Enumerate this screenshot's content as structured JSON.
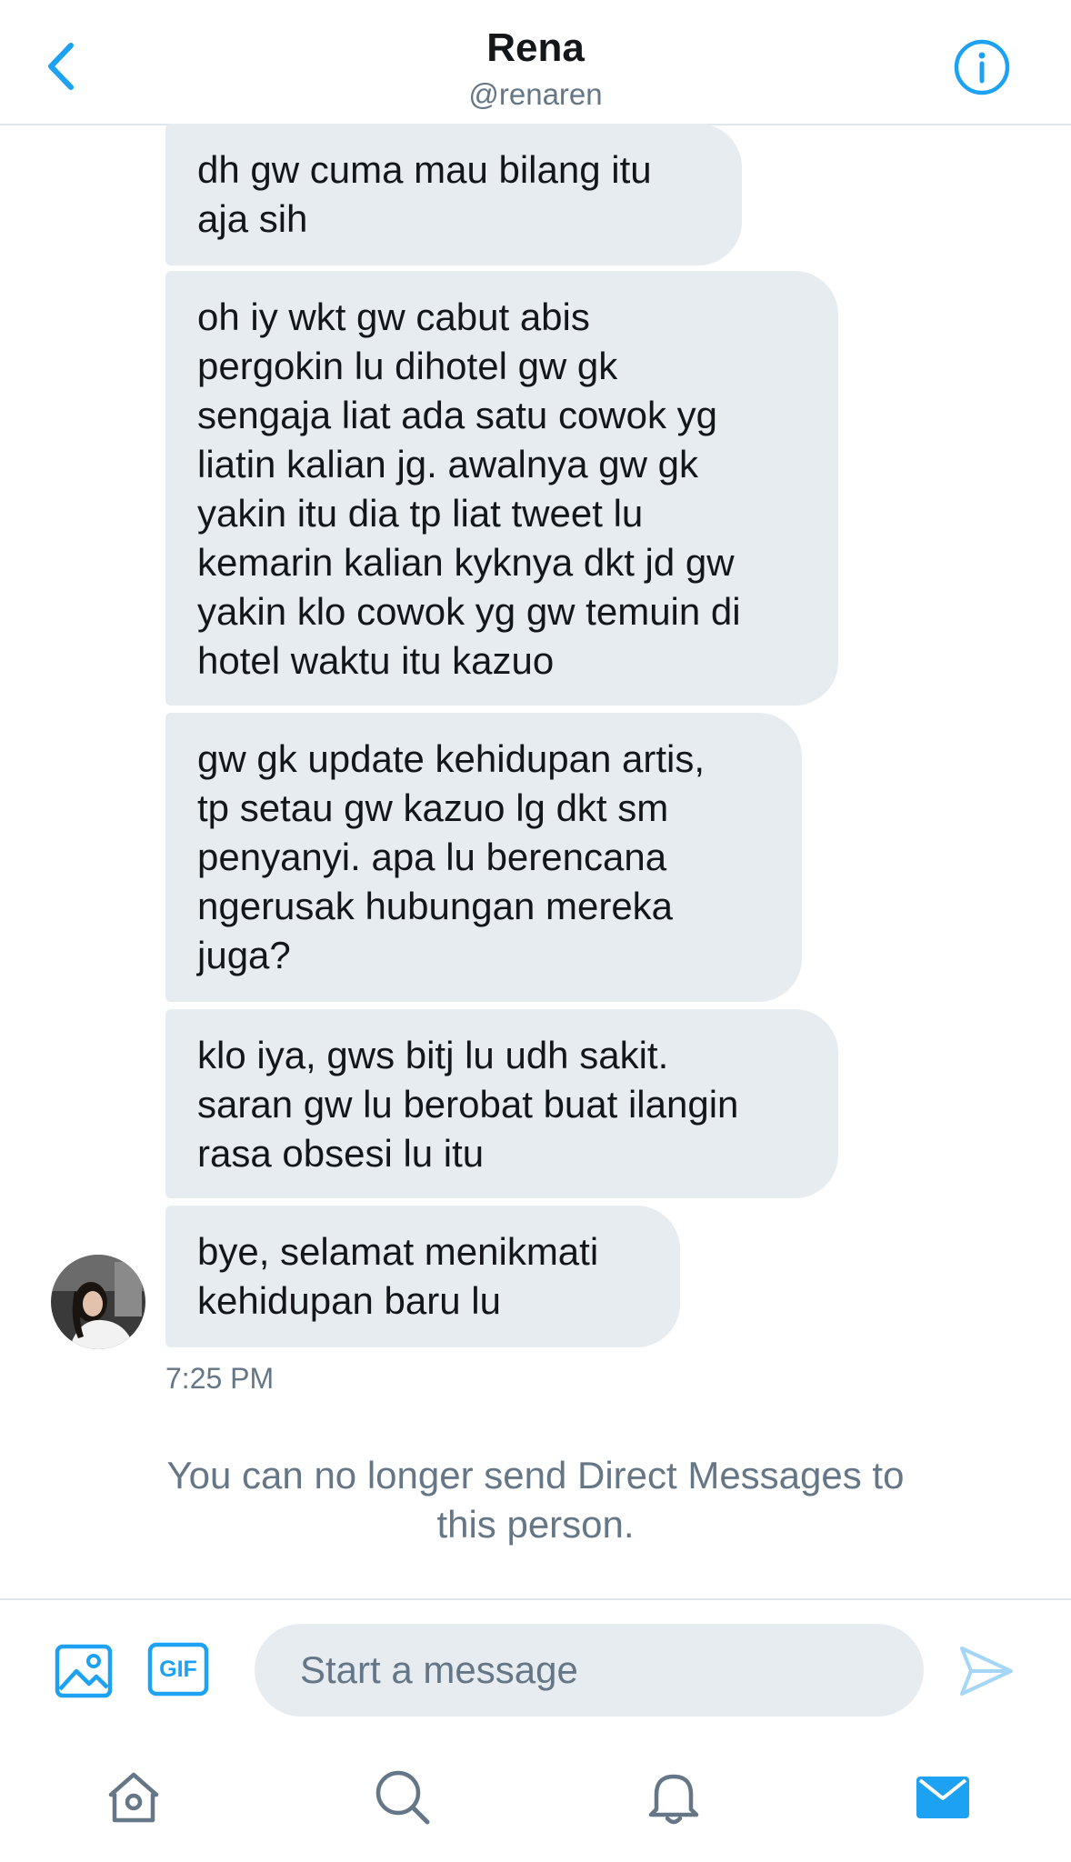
{
  "header": {
    "name": "Rena",
    "handle": "@renaren",
    "back_icon": "chevron-left-icon",
    "info_icon": "info-icon"
  },
  "messages": [
    {
      "text": "dh gw cuma mau bilang itu\naja sih"
    },
    {
      "text": "oh iy wkt gw cabut abis\npergokin lu dihotel gw gk\nsengaja liat ada satu cowok yg\nliatin kalian jg. awalnya gw gk\nyakin itu dia tp liat tweet lu\nkemarin kalian kyknya dkt jd gw\nyakin klo cowok yg gw temuin di\nhotel waktu itu kazuo"
    },
    {
      "text": "gw gk update kehidupan artis,\ntp setau gw kazuo lg dkt sm\npenyanyi. apa lu berencana\nngerusak hubungan mereka\njuga?"
    },
    {
      "text": "klo iya, gws bitj lu udh sakit.\nsaran gw lu berobat buat ilangin\nrasa obsesi lu itu"
    },
    {
      "text": "bye, selamat menikmati\nkehidupan baru lu"
    }
  ],
  "timestamp": "7:25 PM",
  "notice": "You can no longer send Direct Messages to\nthis person.",
  "composer": {
    "placeholder": "Start a message",
    "gif_label": "GIF",
    "icons": [
      "image-icon",
      "gif-icon",
      "send-icon"
    ]
  },
  "tabbar": {
    "icons": [
      "home-icon",
      "search-icon",
      "bell-icon",
      "mail-icon"
    ]
  },
  "colors": {
    "accent": "#1da1f2",
    "bubble": "#e6ecf0",
    "muted": "#657786",
    "divider": "#e1e8ed"
  }
}
